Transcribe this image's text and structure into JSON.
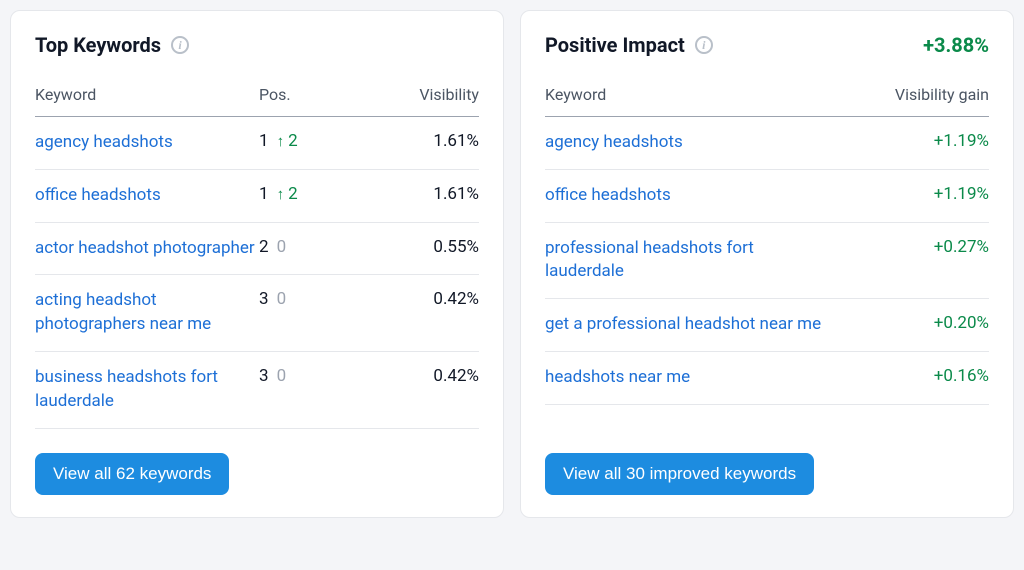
{
  "top_keywords": {
    "title": "Top Keywords",
    "columns": {
      "keyword": "Keyword",
      "pos": "Pos.",
      "visibility": "Visibility"
    },
    "rows": [
      {
        "keyword": "agency headshots",
        "pos": "1",
        "delta": "2",
        "delta_dir": "up",
        "visibility": "1.61%"
      },
      {
        "keyword": "office headshots",
        "pos": "1",
        "delta": "2",
        "delta_dir": "up",
        "visibility": "1.61%"
      },
      {
        "keyword": "actor headshot photographer",
        "pos": "2",
        "delta": "0",
        "delta_dir": "none",
        "visibility": "0.55%"
      },
      {
        "keyword": "acting headshot photographers near me",
        "pos": "3",
        "delta": "0",
        "delta_dir": "none",
        "visibility": "0.42%"
      },
      {
        "keyword": "business headshots fort lauderdale",
        "pos": "3",
        "delta": "0",
        "delta_dir": "none",
        "visibility": "0.42%"
      }
    ],
    "button": "View all 62 keywords"
  },
  "positive_impact": {
    "title": "Positive Impact",
    "overall": "+3.88%",
    "columns": {
      "keyword": "Keyword",
      "visibility_gain": "Visibility gain"
    },
    "rows": [
      {
        "keyword": "agency headshots",
        "gain": "+1.19%"
      },
      {
        "keyword": "office headshots",
        "gain": "+1.19%"
      },
      {
        "keyword": "professional headshots fort lauderdale",
        "gain": "+0.27%"
      },
      {
        "keyword": "get a professional headshot near me",
        "gain": "+0.20%"
      },
      {
        "keyword": "headshots near me",
        "gain": "+0.16%"
      }
    ],
    "button": "View all 30 improved keywords"
  }
}
